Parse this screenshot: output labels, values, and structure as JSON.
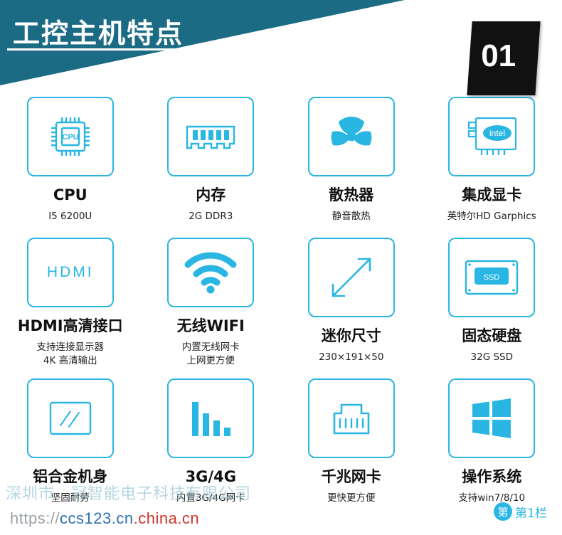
{
  "header": {
    "title": "工控主机特点",
    "badge_number": "01",
    "background_color": "#1b6b84",
    "badge_color": "#111111"
  },
  "theme": {
    "accent": "#29b6e3",
    "text": "#111111"
  },
  "features": [
    {
      "icon": "cpu-chip-icon",
      "title": "CPU",
      "subtitle": "I5  6200U"
    },
    {
      "icon": "memory-ram-icon",
      "title": "内存",
      "subtitle": "2G  DDR3"
    },
    {
      "icon": "cooling-fan-icon",
      "title": "散热器",
      "subtitle": "静音散热"
    },
    {
      "icon": "intel-graphics-card-icon",
      "title": "集成显卡",
      "subtitle": "英特尔HD Garphics"
    },
    {
      "icon": "hdmi-text-icon",
      "title": "HDMI高清接口",
      "subtitle": "支持连接显示器\n4K  高清输出"
    },
    {
      "icon": "wifi-signal-icon",
      "title": "无线WIFI",
      "subtitle": "内置无线网卡\n上网更方便"
    },
    {
      "icon": "diagonal-arrow-icon",
      "title": "迷你尺寸",
      "subtitle": "230×191×50"
    },
    {
      "icon": "ssd-drive-icon",
      "title": "固态硬盘",
      "subtitle": "32G    SSD"
    },
    {
      "icon": "aluminum-case-icon",
      "title": "铝合金机身",
      "subtitle": "坚固耐劳"
    },
    {
      "icon": "signal-bars-icon",
      "title": "3G/4G",
      "subtitle": "内置3G/4G网卡"
    },
    {
      "icon": "rj45-ethernet-icon",
      "title": "千兆网卡",
      "subtitle": "更快更方便"
    },
    {
      "icon": "windows-logo-icon",
      "title": "操作系统",
      "subtitle": "支持win7/8/10"
    }
  ],
  "watermarks": {
    "company": "深圳市　冠智能电子科技有限公司",
    "url_prefix": "https://",
    "url_main": "ccs123.cn",
    "url_suffix": ".china.cn",
    "logo_mark": "第",
    "logo_text": "第1栏"
  },
  "intel_label": "intel",
  "ssd_label": "SSD",
  "cpu_label": "CPU",
  "hdmi_label": "HDMI"
}
